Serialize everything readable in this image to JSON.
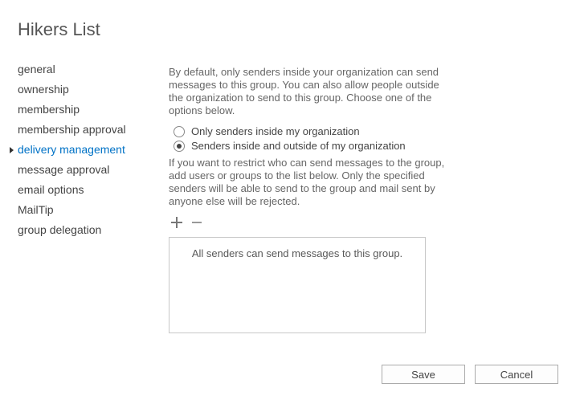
{
  "title": "Hikers List",
  "sidebar": {
    "items": [
      {
        "label": "general",
        "active": false
      },
      {
        "label": "ownership",
        "active": false
      },
      {
        "label": "membership",
        "active": false
      },
      {
        "label": "membership approval",
        "active": false
      },
      {
        "label": "delivery management",
        "active": true
      },
      {
        "label": "message approval",
        "active": false
      },
      {
        "label": "email options",
        "active": false
      },
      {
        "label": "MailTip",
        "active": false
      },
      {
        "label": "group delegation",
        "active": false
      }
    ]
  },
  "main": {
    "intro": "By default, only senders inside your organization can send messages to this group. You can also allow people outside the organization to send to this group. Choose one of the options below.",
    "radio_inside": "Only senders inside my organization",
    "radio_both": "Senders inside and outside of my organization",
    "selected_option": "both",
    "restrict": "If you want to restrict who can send messages to the group, add users or groups to the list below. Only the specified senders will be able to send to the group and mail sent by anyone else will be rejected.",
    "listbox_placeholder": "All senders can send messages to this group."
  },
  "footer": {
    "save": "Save",
    "cancel": "Cancel"
  }
}
